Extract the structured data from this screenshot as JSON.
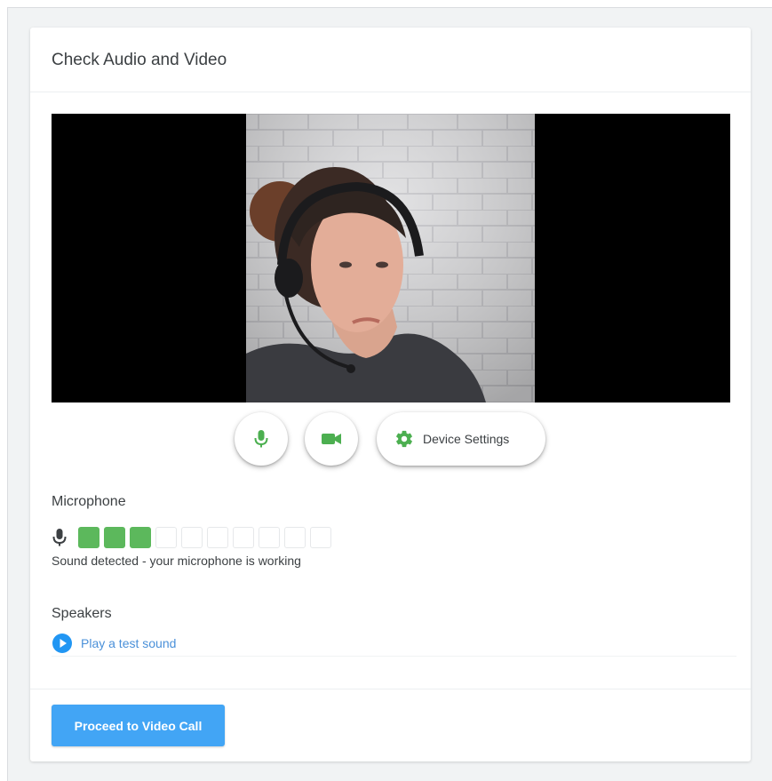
{
  "dialog": {
    "title": "Check Audio and Video"
  },
  "controls": {
    "microphone_button_icon": "microphone-icon",
    "camera_button_icon": "video-camera-icon",
    "device_settings_icon": "gear-icon",
    "device_settings_label": "Device Settings",
    "accent_color": "#4caf50"
  },
  "microphone": {
    "section_title": "Microphone",
    "icon": "microphone-icon",
    "level_segments_total": 10,
    "level_segments_active": 3,
    "level_color": "#5cb85c",
    "status_text": "Sound detected - your microphone is working"
  },
  "speakers": {
    "section_title": "Speakers",
    "icon": "play-circle-icon",
    "test_sound_label": "Play a test sound",
    "link_color": "#4a90d9"
  },
  "footer": {
    "proceed_label": "Proceed to Video Call",
    "button_color": "#42a5f5"
  }
}
